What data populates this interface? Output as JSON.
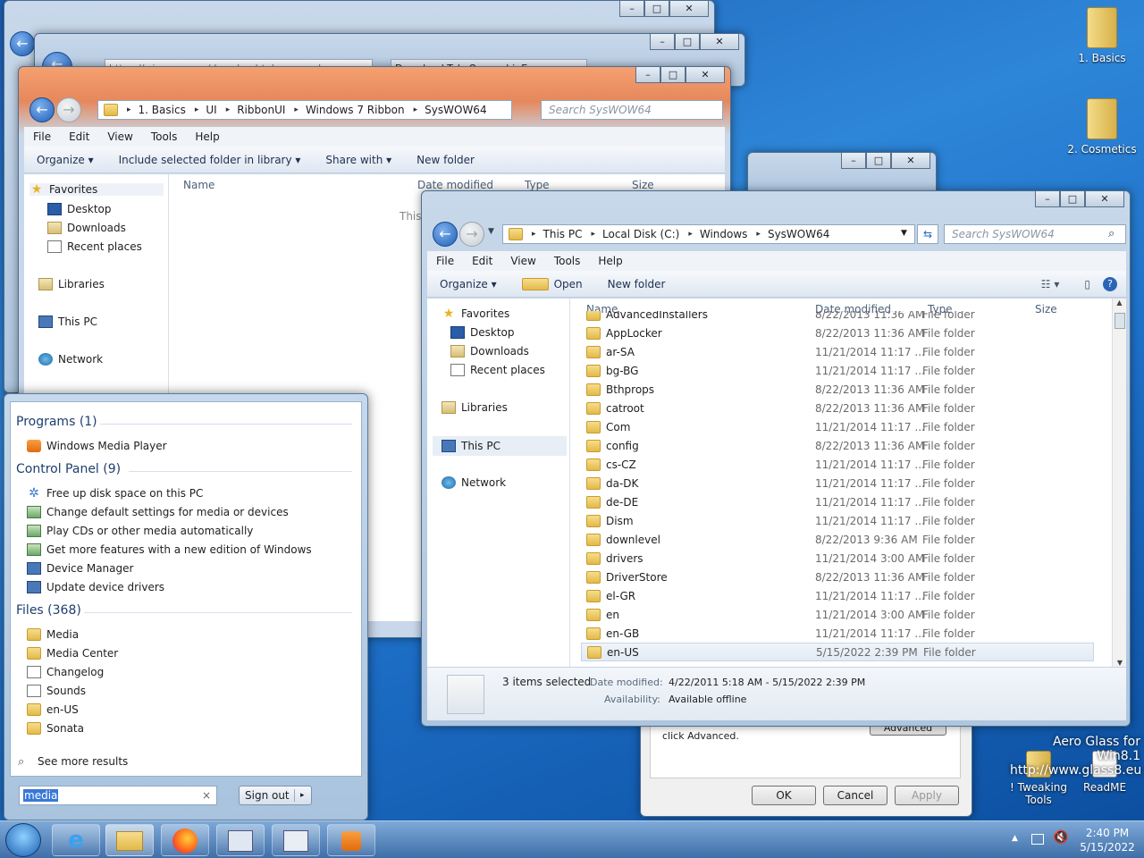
{
  "desktop": {
    "icons": [
      {
        "label": "1. Basics"
      },
      {
        "label": "2. Cosmetics"
      },
      {
        "label": "! Tweaking Tools"
      },
      {
        "label": "ReadME"
      }
    ],
    "watermark_line1": "Aero Glass for Win8.1",
    "watermark_line2": "http://www.glass8.eu"
  },
  "browser_tabs": {
    "tab1": "https://winaero.com/download-takeownersh...",
    "tab2": "Download TakeOwnershipEx..."
  },
  "explorer_back": {
    "address": [
      "1. Basics",
      "UI",
      "RibbonUI",
      "Windows 7 Ribbon",
      "SysWOW64"
    ],
    "search_placeholder": "Search SysWOW64",
    "menu": [
      "File",
      "Edit",
      "View",
      "Tools",
      "Help"
    ],
    "commands": [
      "Organize ▾",
      "Include selected folder in library ▾",
      "Share with ▾",
      "New folder"
    ],
    "columns": [
      "Name",
      "Date modified",
      "Type",
      "Size"
    ],
    "empty_text": "This"
  },
  "explorer_front": {
    "address": [
      "This PC",
      "Local Disk (C:)",
      "Windows",
      "SysWOW64"
    ],
    "search_placeholder": "Search SysWOW64",
    "menu": [
      "File",
      "Edit",
      "View",
      "Tools",
      "Help"
    ],
    "commands": [
      "Organize ▾",
      "Open",
      "New folder"
    ],
    "columns": [
      "Name",
      "Date modified",
      "Type",
      "Size"
    ],
    "rows": [
      {
        "name": "AdvancedInstallers",
        "date": "8/22/2013 11:36 AM",
        "type": "File folder"
      },
      {
        "name": "AppLocker",
        "date": "8/22/2013 11:36 AM",
        "type": "File folder"
      },
      {
        "name": "ar-SA",
        "date": "11/21/2014 11:17 ...",
        "type": "File folder"
      },
      {
        "name": "bg-BG",
        "date": "11/21/2014 11:17 ...",
        "type": "File folder"
      },
      {
        "name": "Bthprops",
        "date": "8/22/2013 11:36 AM",
        "type": "File folder"
      },
      {
        "name": "catroot",
        "date": "8/22/2013 11:36 AM",
        "type": "File folder"
      },
      {
        "name": "Com",
        "date": "11/21/2014 11:17 ...",
        "type": "File folder"
      },
      {
        "name": "config",
        "date": "8/22/2013 11:36 AM",
        "type": "File folder"
      },
      {
        "name": "cs-CZ",
        "date": "11/21/2014 11:17 ...",
        "type": "File folder"
      },
      {
        "name": "da-DK",
        "date": "11/21/2014 11:17 ...",
        "type": "File folder"
      },
      {
        "name": "de-DE",
        "date": "11/21/2014 11:17 ...",
        "type": "File folder"
      },
      {
        "name": "Dism",
        "date": "11/21/2014 11:17 ...",
        "type": "File folder"
      },
      {
        "name": "downlevel",
        "date": "8/22/2013 9:36 AM",
        "type": "File folder"
      },
      {
        "name": "drivers",
        "date": "11/21/2014 3:00 AM",
        "type": "File folder"
      },
      {
        "name": "DriverStore",
        "date": "8/22/2013 11:36 AM",
        "type": "File folder"
      },
      {
        "name": "el-GR",
        "date": "11/21/2014 11:17 ...",
        "type": "File folder"
      },
      {
        "name": "en",
        "date": "11/21/2014 3:00 AM",
        "type": "File folder"
      },
      {
        "name": "en-GB",
        "date": "11/21/2014 11:17 ...",
        "type": "File folder"
      },
      {
        "name": "en-US",
        "date": "5/15/2022 2:39 PM",
        "type": "File folder"
      }
    ],
    "details": {
      "count": "3 items selected",
      "date_label": "Date modified:",
      "date_value": "4/22/2011 5:18 AM - 5/15/2022 2:39 PM",
      "avail_label": "Availability:",
      "avail_value": "Available offline"
    }
  },
  "nav": {
    "favorites": "Favorites",
    "desktop": "Desktop",
    "downloads": "Downloads",
    "recent": "Recent places",
    "libraries": "Libraries",
    "thispc": "This PC",
    "network": "Network"
  },
  "dialog": {
    "text": "click Advanced.",
    "advanced": "Advanced",
    "ok": "OK",
    "cancel": "Cancel",
    "apply": "Apply"
  },
  "start_menu": {
    "programs_head": "Programs (1)",
    "programs": [
      "Windows Media Player"
    ],
    "cp_head": "Control Panel (9)",
    "cp": [
      "Free up disk space on this PC",
      "Change default settings for media or devices",
      "Play CDs or other media automatically",
      "Get more features with a new edition of Windows",
      "Device Manager",
      "Update device drivers"
    ],
    "files_head": "Files (368)",
    "files": [
      "Media",
      "Media Center",
      "Changelog",
      "Sounds",
      "en-US",
      "Sonata"
    ],
    "see_more": "See more results",
    "search_value": "media",
    "signout": "Sign out"
  },
  "clock": {
    "time": "2:40 PM",
    "date": "5/15/2022"
  }
}
